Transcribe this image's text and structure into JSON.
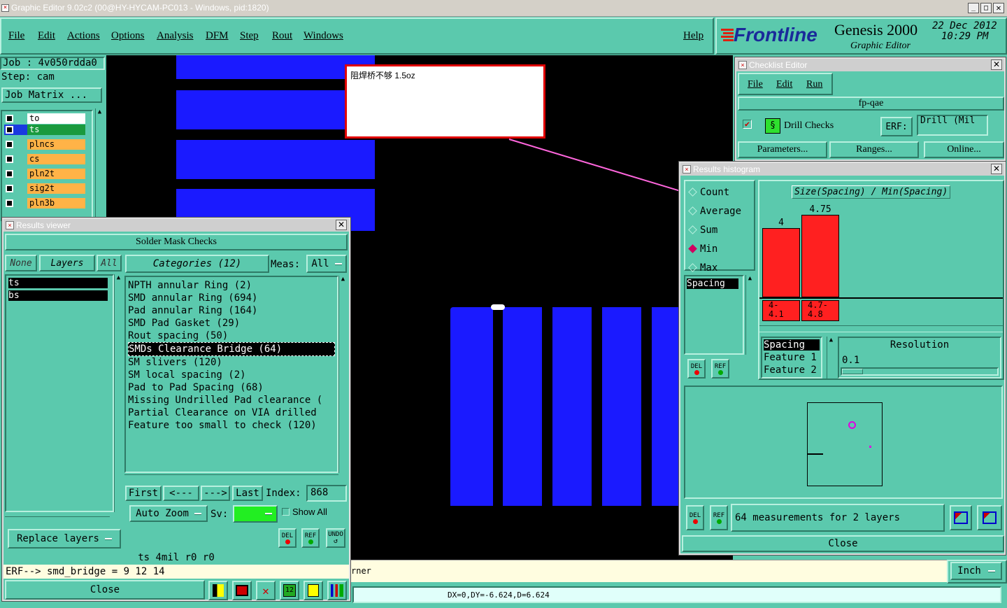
{
  "window": {
    "title": "Graphic Editor 9.02c2 (00@HY-HYCAM-PC013 - Windows, pid:1820)"
  },
  "menu": {
    "items": [
      "File",
      "Edit",
      "Actions",
      "Options",
      "Analysis",
      "DFM",
      "Step",
      "Rout",
      "Windows"
    ],
    "help": "Help"
  },
  "brand": {
    "logo": "Frontline",
    "product": "Genesis 2000",
    "subtitle": "Graphic Editor",
    "date": "22 Dec 2012",
    "time": "10:29 PM"
  },
  "job": {
    "job_label": "Job : 4v050rdda0",
    "step_label": "Step: cam",
    "matrix_button": "Job Matrix ..."
  },
  "layers": [
    {
      "name": "to",
      "bg": "#ffffff"
    },
    {
      "name": "ts",
      "bg": "#1a9a3e"
    },
    {
      "name": "plncs",
      "bg": "#ffb347"
    },
    {
      "name": "cs",
      "bg": "#ffb347"
    },
    {
      "name": "pln2t",
      "bg": "#ffb347"
    },
    {
      "name": "sig2t",
      "bg": "#ffb347"
    },
    {
      "name": "pln3b",
      "bg": "#ffb347"
    }
  ],
  "note": {
    "text": "阻焊桥不够  1.5oz"
  },
  "results_viewer": {
    "title": "Results viewer",
    "header": "Solder Mask Checks",
    "none": "None",
    "layers_btn": "Layers",
    "all": "All",
    "layer_list": [
      "ts",
      "bs"
    ],
    "categories_btn": "Categories (12)",
    "meas_label": "Meas:",
    "meas_value": "All",
    "categories": [
      "NPTH annular Ring (2)",
      "SMD annular Ring (694)",
      "Pad annular Ring (164)",
      "SMD Pad Gasket (29)",
      "Rout spacing (50)",
      "SMDs Clearance Bridge (64)",
      "SM slivers (120)",
      "SM local spacing (2)",
      "Pad to Pad Spacing (68)",
      "Missing Undrilled Pad clearance (",
      "Partial Clearance on VIA drilled",
      "Feature too small to check (120)"
    ],
    "first": "First",
    "prev": "<---",
    "next": "--->",
    "last": "Last",
    "index_label": "Index:",
    "index_value": "868",
    "auto_zoom": "Auto Zoom",
    "sv_label": "Sv:",
    "show_all": "Show All",
    "replace_layers": "Replace layers",
    "del": "DEL",
    "ref": "REF",
    "undo": "UNDO",
    "status": "ts 4mil  r0  r0",
    "erf": "ERF--> smd_bridge = 9 12 14",
    "close": "Close"
  },
  "checklist": {
    "title": "Checklist Editor",
    "menu": [
      "File",
      "Edit",
      "Run"
    ],
    "name": "fp-qae",
    "check_name": "Drill Checks",
    "erf_label": "ERF:",
    "erf_value": "Drill (Mil",
    "parameters": "Parameters...",
    "ranges": "Ranges...",
    "online": "Online..."
  },
  "histogram": {
    "title": "Results histogram",
    "modes": [
      "Count",
      "Average",
      "Sum",
      "Min",
      "Max"
    ],
    "selected_mode": "Min",
    "chart_title": "Size(Spacing) / Min(Spacing)",
    "list_item": "Spacing",
    "feature_list": [
      "Spacing",
      "Feature 1",
      "Feature 2"
    ],
    "resolution_label": "Resolution",
    "resolution_value": "0.1",
    "del": "DEL",
    "ref": "REF",
    "summary": "64 measurements for 2 layers",
    "close": "Close"
  },
  "chart_data": {
    "type": "bar",
    "categories": [
      "4-\n4.1",
      "4.7-\n4.8"
    ],
    "values": [
      4,
      4.75
    ],
    "value_labels": [
      "4",
      "4.75"
    ],
    "ylim": [
      0,
      4.75
    ],
    "color": "#ff2020"
  },
  "bottom": {
    "message": "rner",
    "units": "Inch",
    "coords": "DX=0,DY=-6.624,D=6.624"
  }
}
